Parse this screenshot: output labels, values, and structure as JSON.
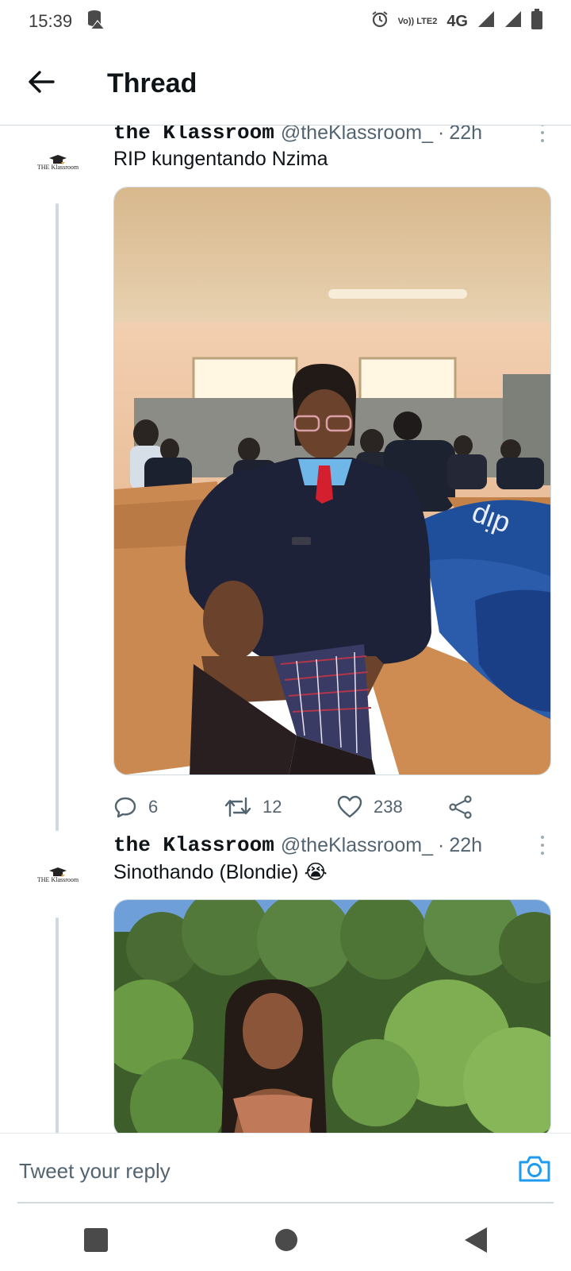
{
  "status_bar": {
    "time": "15:39",
    "left_icons": [
      "database-warning-icon"
    ],
    "volte_label": "Vo)) LTE2",
    "network": "4G",
    "right_icons": [
      "alarm-icon",
      "signal-icon",
      "signal-icon",
      "battery-icon"
    ]
  },
  "header": {
    "back_icon": "arrow-left-icon",
    "title": "Thread"
  },
  "tweets": [
    {
      "avatar_text": "THE Klassroom",
      "author": "the Klassroom",
      "handle": "@theKlassroom_",
      "separator": "·",
      "time": "22h",
      "text": "RIP kungentando Nzima",
      "media": "photo of student in school uniform sitting at a classroom desk",
      "actions": {
        "reply_count": "6",
        "retweet_count": "12",
        "like_count": "238"
      }
    },
    {
      "avatar_text": "THE Klassroom",
      "author": "the Klassroom",
      "handle": "@theKlassroom_",
      "separator": "·",
      "time": "22h",
      "text": "Sinothando (Blondie) 😭",
      "media": "photo of woman outdoors in front of green bushes"
    }
  ],
  "reply": {
    "placeholder": "Tweet your reply",
    "camera_icon": "camera-icon"
  },
  "colors": {
    "accent": "#1d9bf0",
    "text_primary": "#0f1419",
    "text_secondary": "#536471",
    "divider": "#cfd9de"
  }
}
